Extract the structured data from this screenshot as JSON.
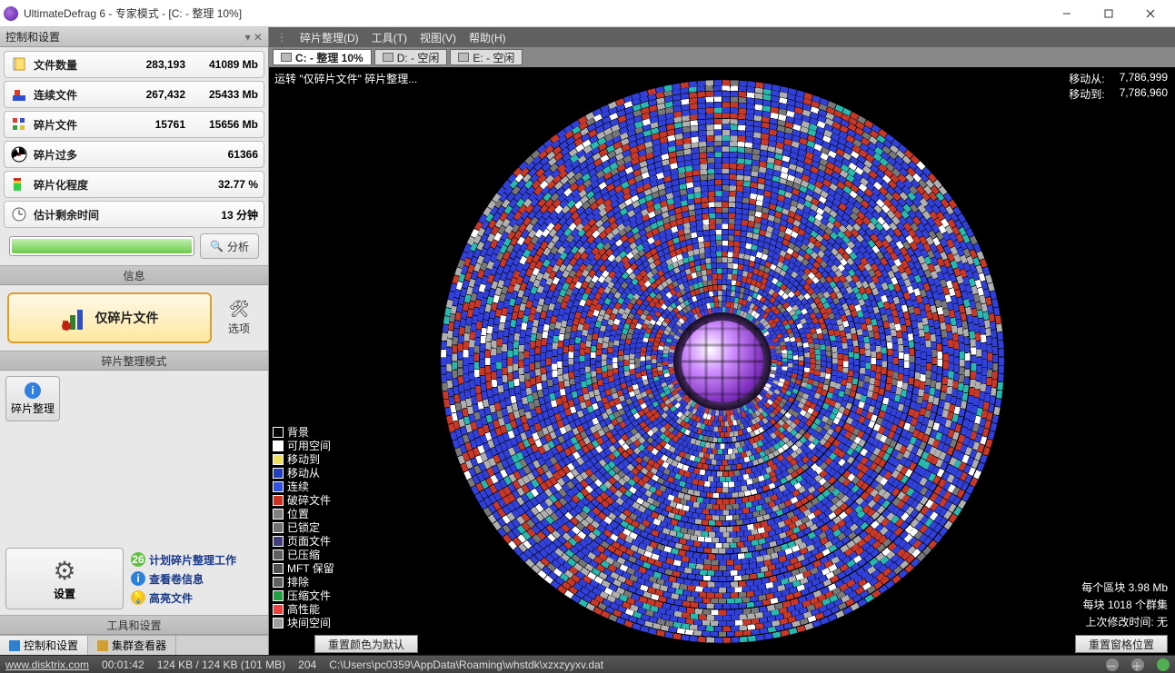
{
  "title": "UltimateDefrag 6 - 专家模式 - [C: - 整理 10%]",
  "sidebar": {
    "header": "控制和设置",
    "stats": [
      {
        "label": "文件数量",
        "v1": "283,193",
        "v2": "41089 Mb"
      },
      {
        "label": "连续文件",
        "v1": "267,432",
        "v2": "25433 Mb"
      },
      {
        "label": "碎片文件",
        "v1": "15761",
        "v2": "15656 Mb"
      },
      {
        "label": "碎片过多",
        "v1": "",
        "v2": "61366"
      },
      {
        "label": "碎片化程度",
        "v1": "",
        "v2": "32.77 %"
      },
      {
        "label": "估计剩余时间",
        "v1": "",
        "v2": "13 分钟"
      }
    ],
    "analyze_btn": "分析",
    "info_label": "信息",
    "mode_btn": "仅碎片文件",
    "options_btn": "选项",
    "mode_label": "碎片整理模式",
    "defrag_tab": "碎片整理",
    "settings_btn": "设置",
    "links": [
      "计划碎片整理工作",
      "查看卷信息",
      "高亮文件"
    ],
    "tools_label": "工具和设置",
    "bottom_tabs": [
      "控制和设置",
      "集群查看器"
    ]
  },
  "menubar": [
    "碎片整理(D)",
    "工具(T)",
    "视图(V)",
    "帮助(H)"
  ],
  "drive_tabs": [
    {
      "label": "C: - 整理 10%",
      "active": true
    },
    {
      "label": "D: - 空闲",
      "active": false
    },
    {
      "label": "E: - 空闲",
      "active": false
    }
  ],
  "viz": {
    "status": "运转 \"仅碎片文件\" 碎片整理...",
    "move_from_label": "移动从:",
    "move_from_val": "7,786,999",
    "move_to_label": "移动到:",
    "move_to_val": "7,786,960",
    "block_size_label": "每个區块 3.98 Mb",
    "cluster_label": "每块 1018 个群集",
    "last_mod_label": "上次修改时间:  无",
    "reset_colors": "重置颜色为默认",
    "reset_window": "重置窗格位置"
  },
  "legend": [
    {
      "label": "背景",
      "color": "#000000"
    },
    {
      "label": "可用空间",
      "color": "#ffffff"
    },
    {
      "label": "移动到",
      "color": "#f0e060"
    },
    {
      "label": "移动从",
      "color": "#2040c0"
    },
    {
      "label": "连续",
      "color": "#3050e0"
    },
    {
      "label": "破碎文件",
      "color": "#d03020"
    },
    {
      "label": "位置",
      "color": "#808080"
    },
    {
      "label": "已锁定",
      "color": "#707070"
    },
    {
      "label": "页面文件",
      "color": "#404080"
    },
    {
      "label": "已压缩",
      "color": "#606060"
    },
    {
      "label": "MFT 保留",
      "color": "#505050"
    },
    {
      "label": "排除",
      "color": "#606060"
    },
    {
      "label": "压缩文件",
      "color": "#20a040"
    },
    {
      "label": "高性能",
      "color": "#f04040"
    },
    {
      "label": "块间空间",
      "color": "#a0a0a0"
    }
  ],
  "statusbar": {
    "url": "www.disktrix.com",
    "time": "00:01:42",
    "mem": "124 KB / 124 KB (101 MB)",
    "num": "204",
    "path": "C:\\Users\\pc0359\\AppData\\Roaming\\whstdk\\xzxzyyxv.dat"
  }
}
